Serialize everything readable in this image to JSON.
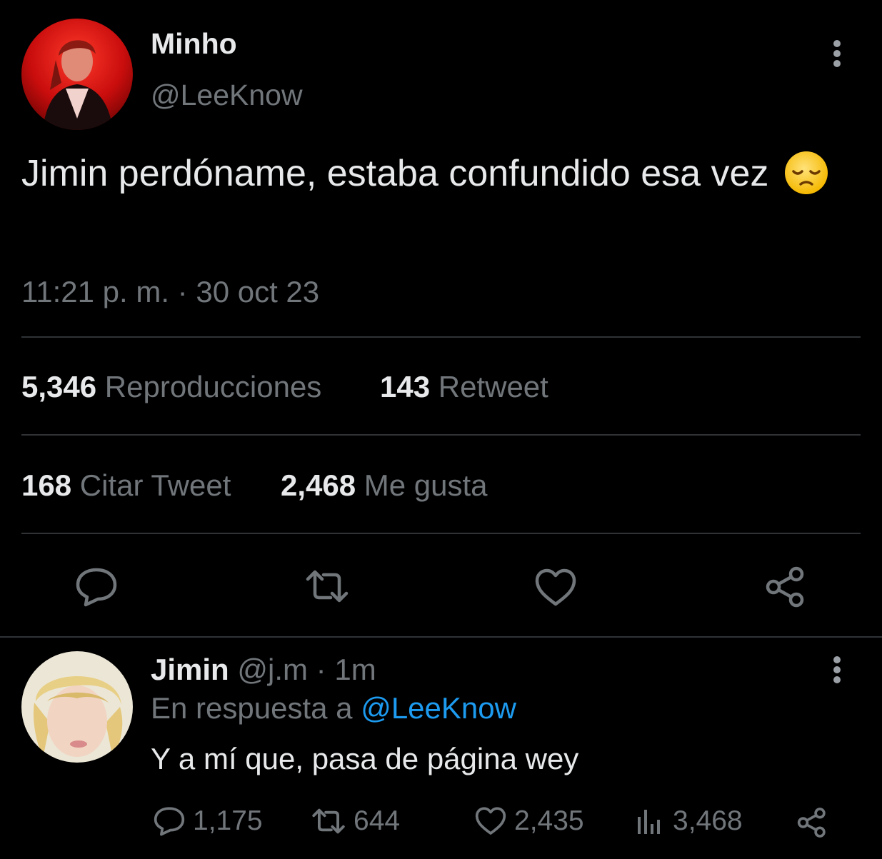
{
  "main_tweet": {
    "display_name": "Minho",
    "handle": "@LeeKnow",
    "text": "Jimin perdóname, estaba confundido esa vez",
    "emoji": "😞",
    "timestamp": "11:21 p. m. · 30 oct 23",
    "stats": {
      "views_count": "5,346",
      "views_label": "Reproducciones",
      "retweets_count": "143",
      "retweets_label": "Retweet",
      "quotes_count": "168",
      "quotes_label": "Citar Tweet",
      "likes_count": "2,468",
      "likes_label": "Me gusta"
    },
    "actions": [
      "reply-icon",
      "retweet-icon",
      "like-icon",
      "share-icon"
    ]
  },
  "reply": {
    "display_name": "Jimin",
    "handle": "@j.m",
    "separator": "·",
    "time": "1m",
    "replying_prefix": "En respuesta a",
    "replying_to": "@LeeKnow",
    "text": "Y a mí que, pasa de página wey",
    "counts": {
      "replies": "1,175",
      "retweets": "644",
      "likes": "2,435",
      "views": "3,468"
    }
  },
  "colors": {
    "background": "#000000",
    "text": "#e7e9ea",
    "muted": "#71767b",
    "link": "#1d9bf0",
    "divider": "#2f3336"
  }
}
